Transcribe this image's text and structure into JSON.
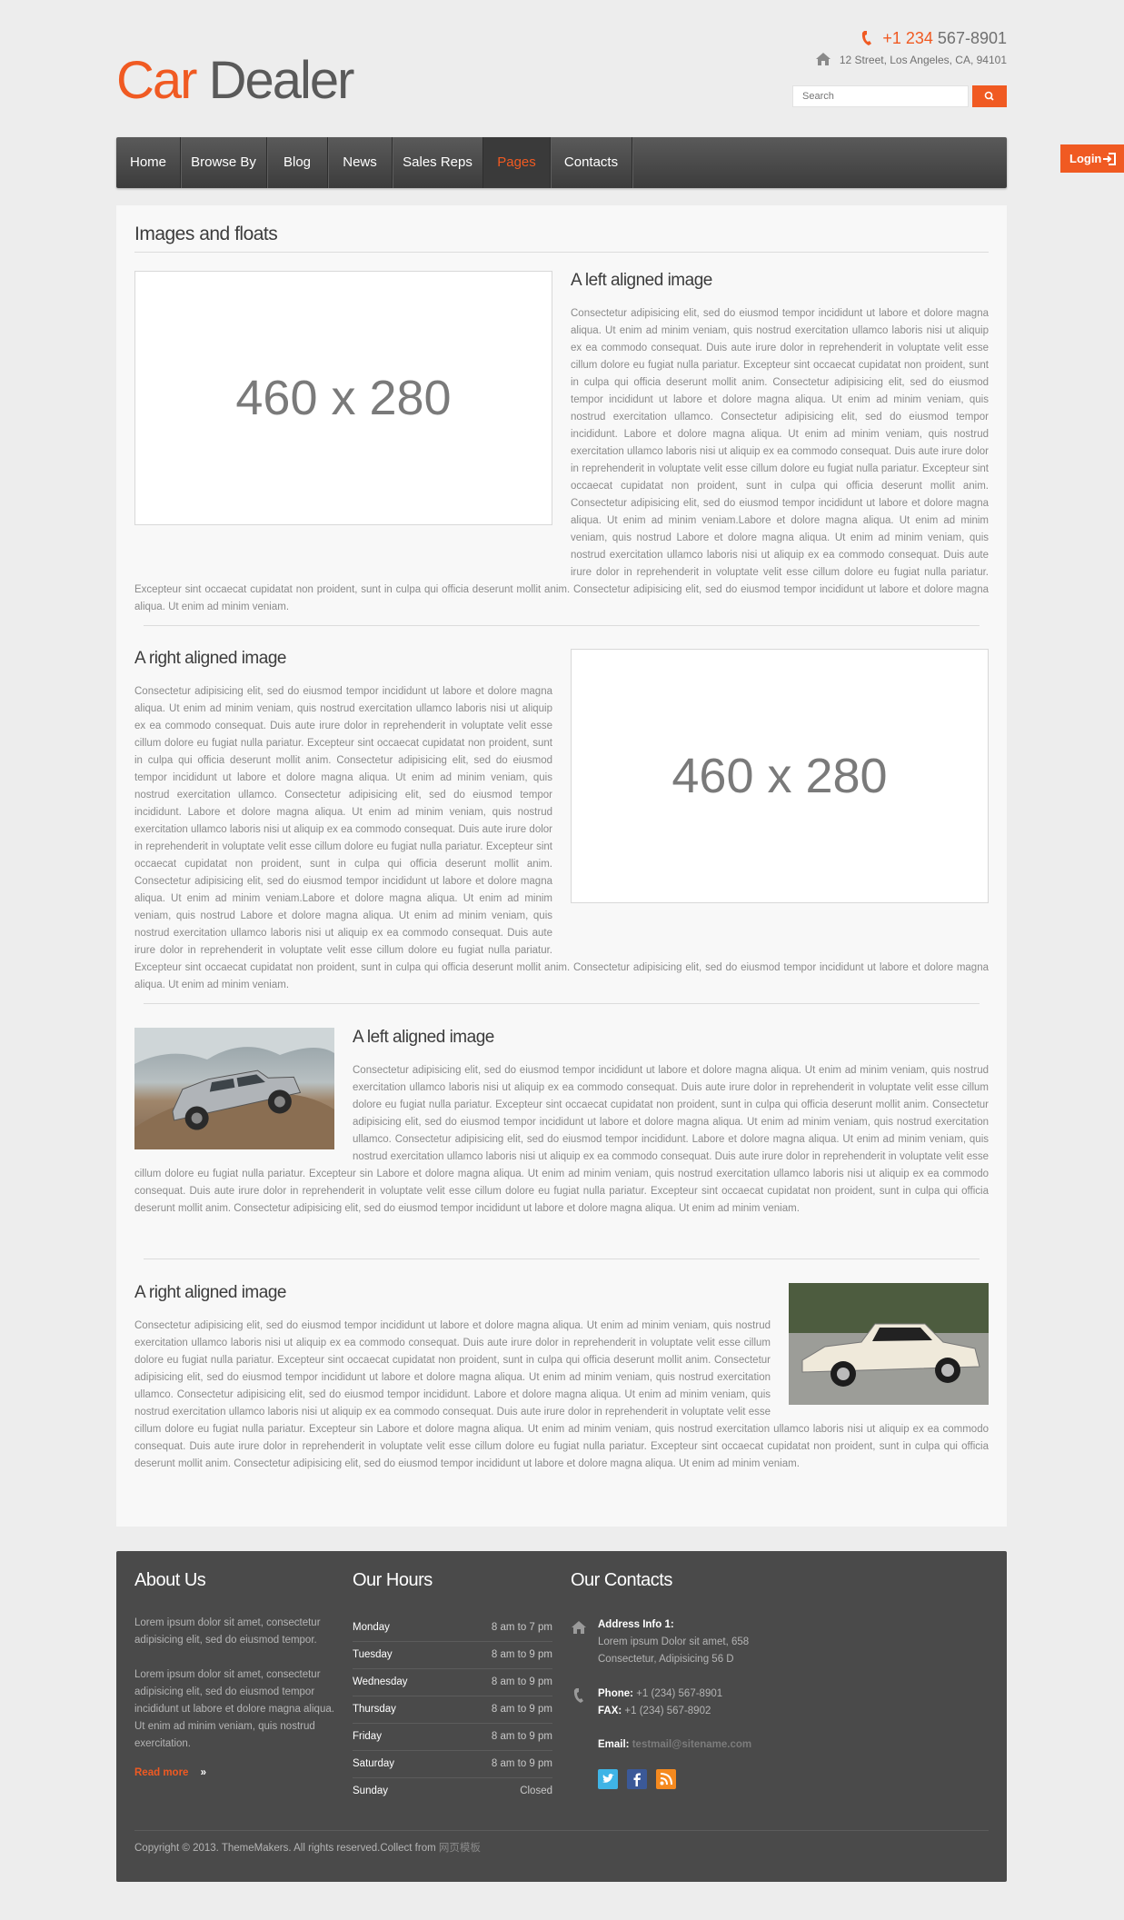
{
  "header": {
    "logo_part1": "Car",
    "logo_part2": "Dealer",
    "phone_accent": "+1 234",
    "phone_rest": "567-8901",
    "address": "12 Street, Los Angeles, CA, 94101",
    "search_placeholder": "Search"
  },
  "login": {
    "label": "Login"
  },
  "nav": {
    "items": [
      {
        "label": "Home"
      },
      {
        "label": "Browse By"
      },
      {
        "label": "Blog"
      },
      {
        "label": "News"
      },
      {
        "label": "Sales Reps"
      },
      {
        "label": "Pages"
      },
      {
        "label": "Contacts"
      }
    ],
    "active": "Pages"
  },
  "main": {
    "page_title": "Images and floats",
    "placeholder_label": "460 x 280",
    "sections": [
      {
        "heading": "A left aligned image",
        "text": "Consectetur adipisicing elit, sed do eiusmod tempor incididunt ut labore et dolore magna aliqua. Ut enim ad minim veniam, quis nostrud exercitation ullamco laboris nisi ut aliquip ex ea commodo consequat. Duis aute irure dolor in reprehenderit in voluptate velit esse cillum dolore eu fugiat nulla pariatur. Excepteur sint occaecat cupidatat non proident, sunt in culpa qui officia deserunt mollit anim. Consectetur adipisicing elit, sed do eiusmod tempor incididunt ut labore et dolore magna aliqua. Ut enim ad minim veniam, quis nostrud exercitation ullamco. Consectetur adipisicing elit, sed do eiusmod tempor incididunt. Labore et dolore magna aliqua. Ut enim ad minim veniam, quis nostrud exercitation ullamco laboris nisi ut aliquip ex ea commodo consequat. Duis aute irure dolor in reprehenderit in voluptate velit esse cillum dolore eu fugiat nulla pariatur. Excepteur sint occaecat cupidatat non proident, sunt in culpa qui officia deserunt mollit anim. Consectetur adipisicing elit, sed do eiusmod tempor incididunt ut labore et dolore magna aliqua. Ut enim ad minim veniam.Labore et dolore magna aliqua. Ut enim ad minim veniam, quis nostrud Labore et dolore magna aliqua. Ut enim ad minim veniam, quis nostrud exercitation ullamco laboris nisi ut aliquip ex ea commodo consequat. Duis aute irure dolor in reprehenderit in voluptate velit esse cillum dolore eu fugiat nulla pariatur. Excepteur sint occaecat cupidatat non proident, sunt in culpa qui officia deserunt mollit anim. Consectetur adipisicing elit, sed do eiusmod tempor incididunt ut labore et dolore magna aliqua. Ut enim ad minim veniam."
      },
      {
        "heading": "A right aligned image",
        "text": "Consectetur adipisicing elit, sed do eiusmod tempor incididunt ut labore et dolore magna aliqua. Ut enim ad minim veniam, quis nostrud exercitation ullamco laboris nisi ut aliquip ex ea commodo consequat. Duis aute irure dolor in reprehenderit in voluptate velit esse cillum dolore eu fugiat nulla pariatur. Excepteur sint occaecat cupidatat non proident, sunt in culpa qui officia deserunt mollit anim. Consectetur adipisicing elit, sed do eiusmod tempor incididunt ut labore et dolore magna aliqua. Ut enim ad minim veniam, quis nostrud exercitation ullamco. Consectetur adipisicing elit, sed do eiusmod tempor incididunt. Labore et dolore magna aliqua. Ut enim ad minim veniam, quis nostrud exercitation ullamco laboris nisi ut aliquip ex ea commodo consequat. Duis aute irure dolor in reprehenderit in voluptate velit esse cillum dolore eu fugiat nulla pariatur. Excepteur sint occaecat cupidatat non proident, sunt in culpa qui officia deserunt mollit anim. Consectetur adipisicing elit, sed do eiusmod tempor incididunt ut labore et dolore magna aliqua. Ut enim ad minim veniam.Labore et dolore magna aliqua. Ut enim ad minim veniam, quis nostrud Labore et dolore magna aliqua. Ut enim ad minim veniam, quis nostrud exercitation ullamco laboris nisi ut aliquip ex ea commodo consequat. Duis aute irure dolor in reprehenderit in voluptate velit esse cillum dolore eu fugiat nulla pariatur. Excepteur sint occaecat cupidatat non proident, sunt in culpa qui officia deserunt mollit anim. Consectetur adipisicing elit, sed do eiusmod tempor incididunt ut labore et dolore magna aliqua. Ut enim ad minim veniam."
      },
      {
        "heading": "A left aligned image",
        "text": "Consectetur adipisicing elit, sed do eiusmod tempor incididunt ut labore et dolore magna aliqua. Ut enim ad minim veniam, quis nostrud exercitation ullamco laboris nisi ut aliquip ex ea commodo consequat. Duis aute irure dolor in reprehenderit in voluptate velit esse cillum dolore eu fugiat nulla pariatur. Excepteur sint occaecat cupidatat non proident, sunt in culpa qui officia deserunt mollit anim. Consectetur adipisicing elit, sed do eiusmod tempor incididunt ut labore et dolore magna aliqua. Ut enim ad minim veniam, quis nostrud exercitation ullamco. Consectetur adipisicing elit, sed do eiusmod tempor incididunt. Labore et dolore magna aliqua. Ut enim ad minim veniam, quis nostrud exercitation ullamco laboris nisi ut aliquip ex ea commodo consequat. Duis aute irure dolor in reprehenderit in voluptate velit esse cillum dolore eu fugiat nulla pariatur. Excepteur sin Labore et dolore magna aliqua. Ut enim ad minim veniam, quis nostrud exercitation ullamco laboris nisi ut aliquip ex ea commodo consequat. Duis aute irure dolor in reprehenderit in voluptate velit esse cillum dolore eu fugiat nulla pariatur. Excepteur sint occaecat cupidatat non proident, sunt in culpa qui officia deserunt mollit anim. Consectetur adipisicing elit, sed do eiusmod tempor incididunt ut labore et dolore magna aliqua. Ut enim ad minim veniam."
      },
      {
        "heading": "A right aligned image",
        "text": "Consectetur adipisicing elit, sed do eiusmod tempor incididunt ut labore et dolore magna aliqua. Ut enim ad minim veniam, quis nostrud exercitation ullamco laboris nisi ut aliquip ex ea commodo consequat. Duis aute irure dolor in reprehenderit in voluptate velit esse cillum dolore eu fugiat nulla pariatur. Excepteur sint occaecat cupidatat non proident, sunt in culpa qui officia deserunt mollit anim. Consectetur adipisicing elit, sed do eiusmod tempor incididunt ut labore et dolore magna aliqua. Ut enim ad minim veniam, quis nostrud exercitation ullamco. Consectetur adipisicing elit, sed do eiusmod tempor incididunt. Labore et dolore magna aliqua. Ut enim ad minim veniam, quis nostrud exercitation ullamco laboris nisi ut aliquip ex ea commodo consequat. Duis aute irure dolor in reprehenderit in voluptate velit esse cillum dolore eu fugiat nulla pariatur. Excepteur sin Labore et dolore magna aliqua. Ut enim ad minim veniam, quis nostrud exercitation ullamco laboris nisi ut aliquip ex ea commodo consequat. Duis aute irure dolor in reprehenderit in voluptate velit esse cillum dolore eu fugiat nulla pariatur. Excepteur sint occaecat cupidatat non proident, sunt in culpa qui officia deserunt mollit anim. Consectetur adipisicing elit, sed do eiusmod tempor incididunt ut labore et dolore magna aliqua. Ut enim ad minim veniam."
      }
    ]
  },
  "footer": {
    "about": {
      "title": "About Us",
      "p1": "Lorem ipsum dolor sit amet, consectetur adipisicing elit, sed do eiusmod tempor.",
      "p2": "Lorem ipsum dolor sit amet, consectetur adipisicing elit, sed do eiusmod tempor incididunt ut labore et dolore magna aliqua. Ut enim ad minim veniam, quis nostrud exercitation.",
      "read_more": "Read more"
    },
    "hours": {
      "title": "Our Hours",
      "rows": [
        {
          "day": "Monday",
          "time": "8 am to 7 pm"
        },
        {
          "day": "Tuesday",
          "time": "8 am to 9 pm"
        },
        {
          "day": "Wednesday",
          "time": "8 am to 9 pm"
        },
        {
          "day": "Thursday",
          "time": "8 am to 9 pm"
        },
        {
          "day": "Friday",
          "time": "8 am to 9 pm"
        },
        {
          "day": "Saturday",
          "time": "8 am to 9 pm"
        },
        {
          "day": "Sunday",
          "time": "Closed"
        }
      ]
    },
    "contacts": {
      "title": "Our Contacts",
      "address_label": "Address Info 1:",
      "address_line1": "Lorem ipsum Dolor sit amet, 658",
      "address_line2": "Consectetur, Adipisicing 56 D",
      "phone_label": "Phone:",
      "phone": "+1 (234) 567-8901",
      "fax_label": "FAX:",
      "fax": "+1 (234) 567-8902",
      "email_label": "Email:",
      "email": "testmail@sitename.com"
    },
    "copyright": "Copyright © 2013. ThemeMakers. All rights reserved.Collect from",
    "copyright_link": "网页模板"
  },
  "colors": {
    "accent": "#f05a22",
    "footer_bg": "#4a4a4a",
    "nav_bg": "#474747"
  },
  "icons": [
    "phone-icon",
    "home-icon",
    "search-icon",
    "login-icon",
    "twitter-icon",
    "facebook-icon",
    "rss-icon"
  ]
}
